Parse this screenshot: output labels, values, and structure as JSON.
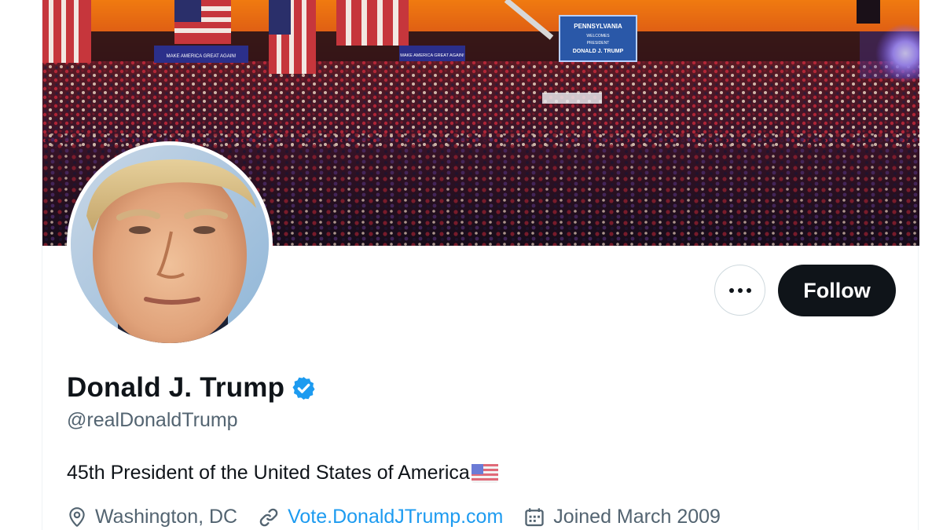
{
  "profile": {
    "display_name": "Donald J. Trump",
    "handle": "@realDonaldTrump",
    "bio": "45th President of the United States of America",
    "bio_emoji": "us-flag-emoji",
    "verified": true,
    "location": "Washington, DC",
    "website": "Vote.DonaldJTrump.com",
    "joined": "Joined March 2009"
  },
  "actions": {
    "follow_label": "Follow",
    "more_icon": "ellipsis-icon"
  },
  "banner": {
    "sign_text": [
      "PENNSYLVANIA",
      "WELCOMES",
      "PRESIDENT",
      "DONALD J. TRUMP"
    ],
    "banner_text_left": "MAKE AMERICA GREAT AGAIN!",
    "banner_text_mid": "MAKE AMERICA GREAT AGAIN!"
  },
  "colors": {
    "accent": "#1d9bf0",
    "verified_badge": "#1d9bf0",
    "text_primary": "#0f1419",
    "text_secondary": "#536471",
    "follow_bg": "#0f1419"
  },
  "icons": {
    "location": "location-pin-icon",
    "link": "link-icon",
    "calendar": "calendar-icon",
    "verified": "verified-badge-icon"
  }
}
